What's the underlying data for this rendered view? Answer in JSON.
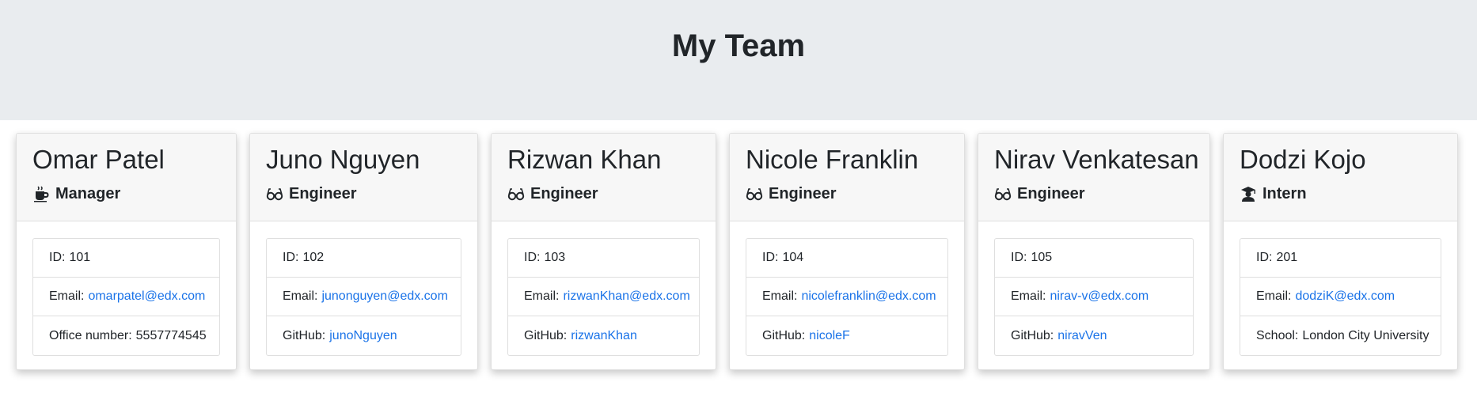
{
  "header": {
    "title": "My Team"
  },
  "colors": {
    "hero_background": "#e9ecef",
    "card_header_background": "#f7f7f7",
    "link": "#1a73e8",
    "text": "#212529"
  },
  "team": [
    {
      "name": "Omar Patel",
      "role": "Manager",
      "icon": "coffee-mug-icon",
      "id_label": "ID:",
      "id": "101",
      "email_label": "Email:",
      "email": "omarpatel@edx.com",
      "extra_label": "Office number:",
      "extra": "5557774545"
    },
    {
      "name": "Juno Nguyen",
      "role": "Engineer",
      "icon": "glasses-icon",
      "id_label": "ID:",
      "id": "102",
      "email_label": "Email:",
      "email": "junonguyen@edx.com",
      "extra_label": "GitHub:",
      "extra": "junoNguyen"
    },
    {
      "name": "Rizwan Khan",
      "role": "Engineer",
      "icon": "glasses-icon",
      "id_label": "ID:",
      "id": "103",
      "email_label": "Email:",
      "email": "rizwanKhan@edx.com",
      "extra_label": "GitHub:",
      "extra": "rizwanKhan"
    },
    {
      "name": "Nicole Franklin",
      "role": "Engineer",
      "icon": "glasses-icon",
      "id_label": "ID:",
      "id": "104",
      "email_label": "Email:",
      "email": "nicolefranklin@edx.com",
      "extra_label": "GitHub:",
      "extra": "nicoleF"
    },
    {
      "name": "Nirav Venkatesan",
      "role": "Engineer",
      "icon": "glasses-icon",
      "id_label": "ID:",
      "id": "105",
      "email_label": "Email:",
      "email": "nirav-v@edx.com",
      "extra_label": "GitHub:",
      "extra": "niravVen"
    },
    {
      "name": "Dodzi Kojo",
      "role": "Intern",
      "icon": "graduate-icon",
      "id_label": "ID:",
      "id": "201",
      "email_label": "Email:",
      "email": "dodziK@edx.com",
      "extra_label": "School:",
      "extra": "London City University"
    }
  ]
}
